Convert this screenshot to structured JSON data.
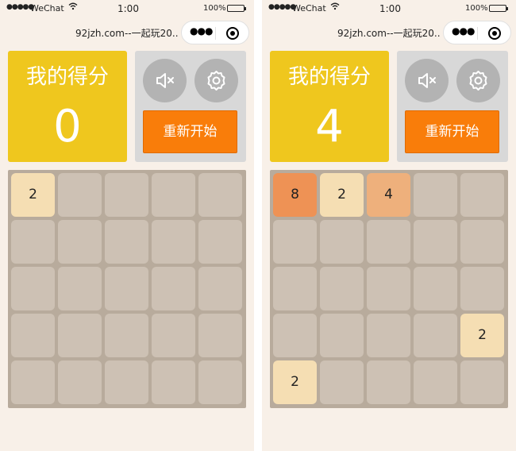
{
  "status_bar": {
    "signal": "●●●●●",
    "carrier": "WeChat",
    "wifi_icon": "wifi-icon",
    "time": "1:00",
    "battery": "100%"
  },
  "nav": {
    "title": "92jzh.com--一起玩20...",
    "menu_icon": "more-dots-icon",
    "close_icon": "close-circle-icon"
  },
  "colors": {
    "score_bg": "#efc71e",
    "restart_bg": "#f97d0a",
    "board_bg": "#b8ab9c",
    "empty_cell": "#cdc1b4",
    "tile_2": "#f5deb3",
    "tile_4": "#eeb07c",
    "tile_8": "#ee9255"
  },
  "screens": [
    {
      "score_label": "我的得分",
      "score": "0",
      "mute_icon": "mute-icon",
      "settings_icon": "gear-icon",
      "restart_label": "重新开始",
      "grid": [
        [
          "2",
          "",
          "",
          "",
          ""
        ],
        [
          "",
          "",
          "",
          "",
          ""
        ],
        [
          "",
          "",
          "",
          "",
          ""
        ],
        [
          "",
          "",
          "",
          "",
          ""
        ],
        [
          "",
          "",
          "",
          "",
          ""
        ]
      ]
    },
    {
      "score_label": "我的得分",
      "score": "4",
      "mute_icon": "mute-icon",
      "settings_icon": "gear-icon",
      "restart_label": "重新开始",
      "grid": [
        [
          "8",
          "2",
          "4",
          "",
          ""
        ],
        [
          "",
          "",
          "",
          "",
          ""
        ],
        [
          "",
          "",
          "",
          "",
          ""
        ],
        [
          "",
          "",
          "",
          "",
          "2"
        ],
        [
          "2",
          "",
          "",
          "",
          ""
        ]
      ]
    }
  ]
}
